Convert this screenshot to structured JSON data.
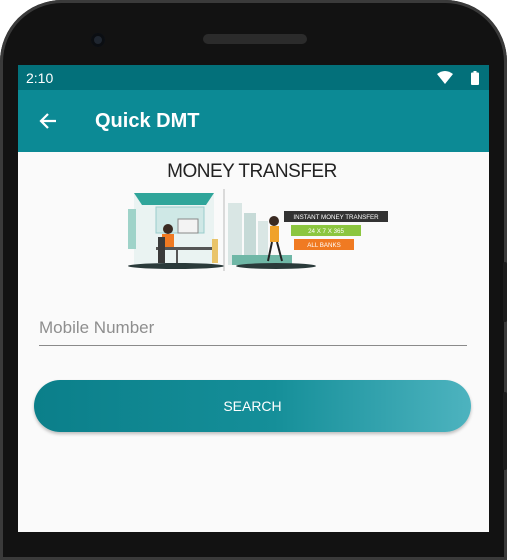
{
  "status_bar": {
    "time": "2:10"
  },
  "app_bar": {
    "title": "Quick DMT"
  },
  "banner": {
    "heading": "MONEY TRANSFER",
    "tags": [
      "INSTANT MONEY TRANSFER",
      "24 X 7 X 365",
      "ALL BANKS"
    ]
  },
  "form": {
    "mobile_placeholder": "Mobile Number",
    "search_label": "SEARCH"
  },
  "colors": {
    "status_bar": "#03707a",
    "app_bar": "#0c8a95",
    "button_start": "#0b7f8a",
    "button_end": "#4db3bf"
  }
}
